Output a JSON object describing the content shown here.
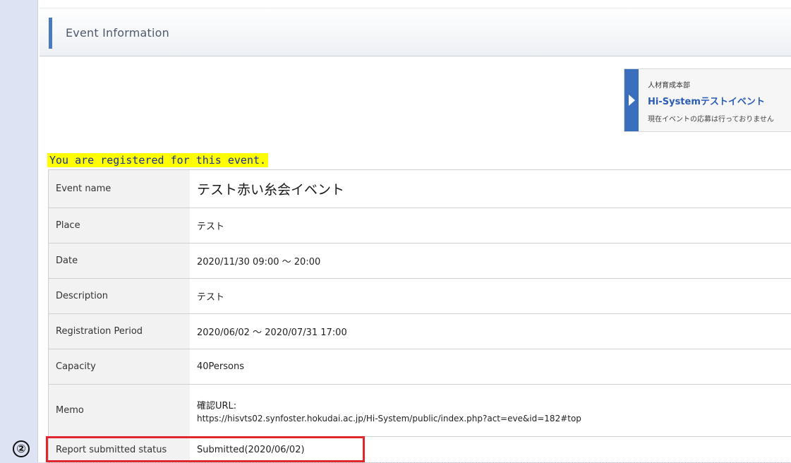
{
  "header": {
    "title": "Event Information"
  },
  "banner": {
    "org": "人材育成本部",
    "title": "Hi-Systemテストイベント",
    "status": "現在イベントの応募は行っておりません"
  },
  "notice": "You are registered for this event.",
  "table": {
    "rows": [
      {
        "label": "Event name",
        "value": "テスト赤い糸会イベント"
      },
      {
        "label": "Place",
        "value": "テスト"
      },
      {
        "label": "Date",
        "value": "2020/11/30 09:00 ～ 20:00"
      },
      {
        "label": "Description",
        "value": "テスト"
      },
      {
        "label": "Registration Period",
        "value": "2020/06/02 ～ 2020/07/31 17:00"
      },
      {
        "label": "Capacity",
        "value": "40Persons"
      },
      {
        "label": "Memo",
        "memo_label": "確認URL:",
        "memo_url": "https://hisvts02.synfoster.hokudai.ac.jp/Hi-System/public/index.php?act=eve&id=182#top"
      },
      {
        "label": "Report submitted status",
        "value": "Submitted(2020/06/02)"
      }
    ]
  },
  "annotation": {
    "marker": "②",
    "highlight_color": "#e0262f"
  },
  "colors": {
    "accent": "#4a79c2",
    "notice_bg": "#ffff00",
    "notice_text": "#1c3296",
    "page_bg": "#dde3f3"
  }
}
